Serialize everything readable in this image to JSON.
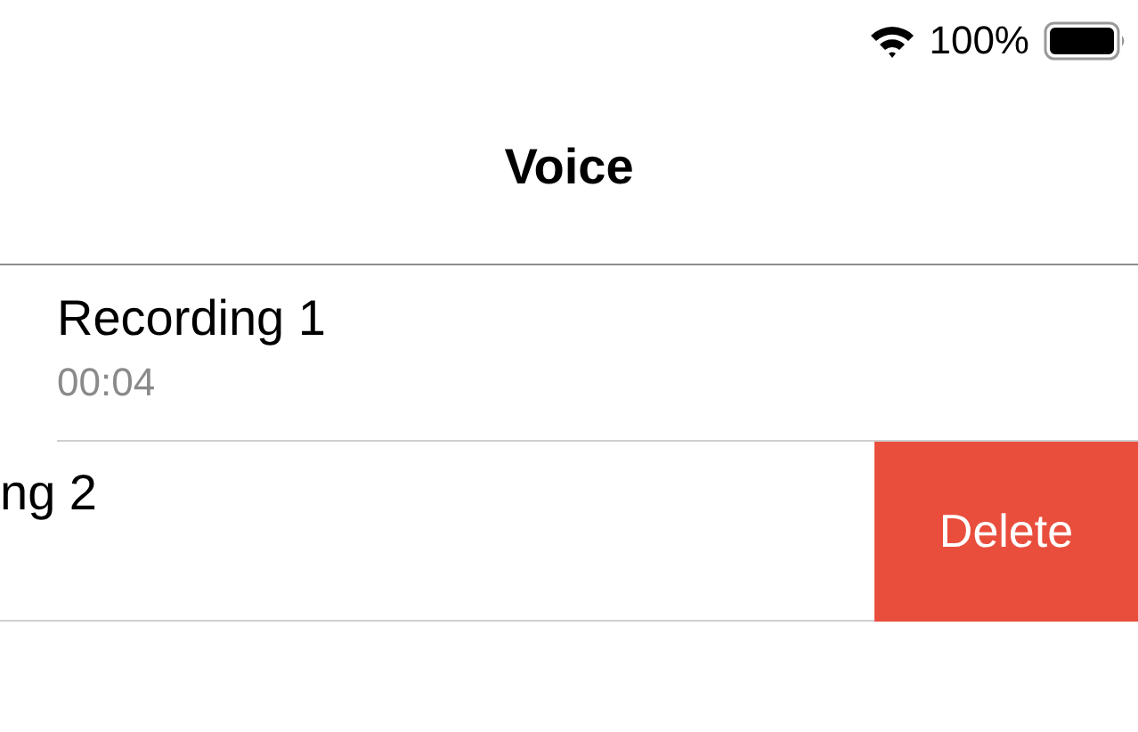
{
  "status_bar": {
    "battery": "100%"
  },
  "navigation": {
    "title": "Voice"
  },
  "recordings": [
    {
      "kind": "normal",
      "name": "Recording 1",
      "duration": "00:04"
    },
    {
      "kind": "swiped",
      "name": "ng 2",
      "action": "Delete"
    }
  ]
}
